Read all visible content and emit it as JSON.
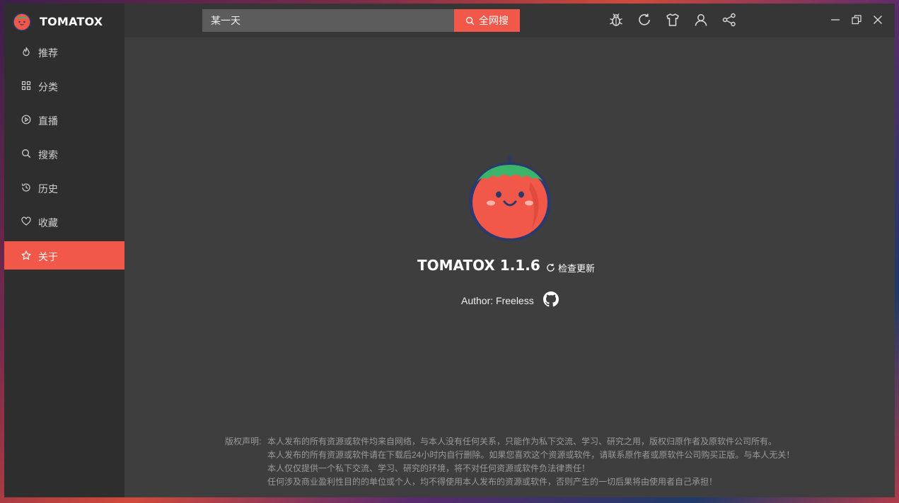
{
  "app": {
    "name": "TOMATOX"
  },
  "sidebar": {
    "items": [
      {
        "label": "推荐",
        "icon": "flame-icon"
      },
      {
        "label": "分类",
        "icon": "grid-icon"
      },
      {
        "label": "直播",
        "icon": "play-circle-icon"
      },
      {
        "label": "搜索",
        "icon": "search-icon"
      },
      {
        "label": "历史",
        "icon": "history-icon"
      },
      {
        "label": "收藏",
        "icon": "heart-icon"
      },
      {
        "label": "关于",
        "icon": "star-icon",
        "active": true
      }
    ]
  },
  "search": {
    "value": "某一天",
    "button_label": "全网搜"
  },
  "toolbar": {
    "icons": [
      "bug-icon",
      "refresh-icon",
      "tshirt-icon",
      "user-icon",
      "share-icon"
    ]
  },
  "window_controls": [
    "minimize-icon",
    "restore-icon",
    "close-icon"
  ],
  "about": {
    "version": "TOMATOX 1.1.6",
    "check_update": "检查更新",
    "author": "Author: Freeless"
  },
  "disclaimer": {
    "label": "版权声明:",
    "lines": [
      "本人发布的所有资源或软件均来自网络，与本人没有任何关系，只能作为私下交流、学习、研究之用，版权归原作者及原软件公司所有。",
      "本人发布的所有资源或软件请在下载后24小时内自行删除。如果您喜欢这个资源或软件，请联系原作者或原软件公司购买正版。与本人无关！",
      "本人仅仅提供一个私下交流、学习、研究的环境，将不对任何资源或软件负法律责任！",
      "任何涉及商业盈利性目的的单位或个人，均不得使用本人发布的资源或软件，否则产生的一切后果将由使用者自己承担！"
    ]
  },
  "colors": {
    "accent": "#f2584a",
    "sidebar": "#2e2e2e",
    "content": "#3e3e3e",
    "topbar": "#363636"
  }
}
